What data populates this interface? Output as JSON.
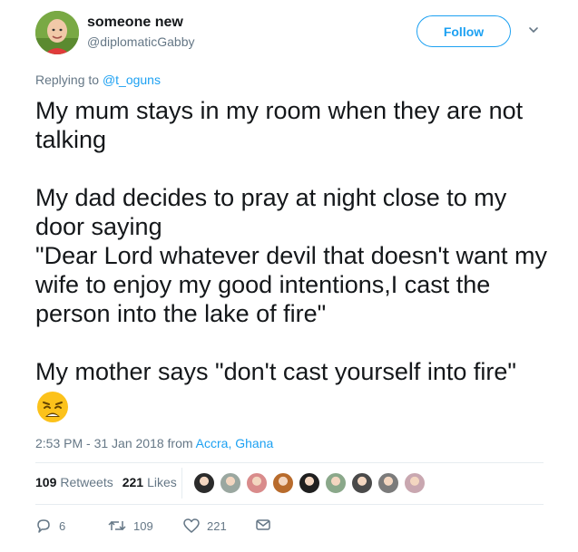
{
  "user": {
    "name": "someone new",
    "handle": "@diplomaticGabby"
  },
  "follow_label": "Follow",
  "reply": {
    "prefix": "Replying to",
    "mention": "@t_oguns"
  },
  "tweet": {
    "text": "My mum stays in my room when they are not talking\n\nMy dad decides to pray at night close to my door saying\n\"Dear Lord whatever devil that doesn't want my wife to enjoy my good intentions,I cast the person into the lake of fire\"\n\nMy mother says \"don't cast yourself into fire\"",
    "emoji": "weary-face"
  },
  "meta": {
    "time": "2:53 PM - 31 Jan 2018 from",
    "location": "Accra, Ghana"
  },
  "stats": {
    "retweets_count": "109",
    "retweets_label": "Retweets",
    "likes_count": "221",
    "likes_label": "Likes"
  },
  "liker_colors": [
    "#2b2b2b",
    "#9aa7a0",
    "#d98b8b",
    "#b86b2c",
    "#1f1f1f",
    "#8aa88a",
    "#4a4a4a",
    "#7b7b7b",
    "#c9a7b0"
  ],
  "actions": {
    "replies": "6",
    "retweets": "109",
    "likes": "221"
  },
  "colors": {
    "accent": "#1da1f2",
    "muted": "#657786",
    "text": "#14171a"
  }
}
